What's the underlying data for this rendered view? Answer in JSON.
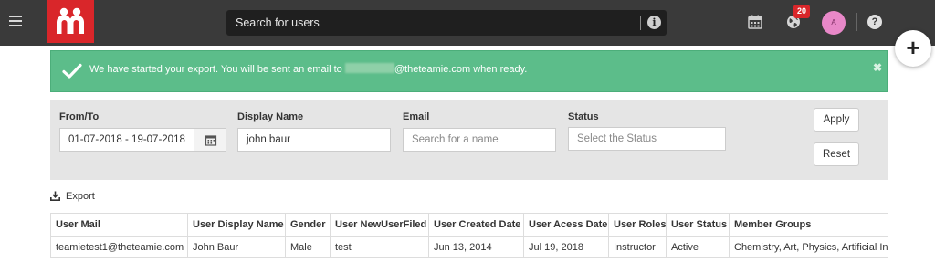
{
  "topbar": {
    "search_placeholder": "Search for users",
    "notification_count": "20",
    "avatar_initial": "A",
    "help_glyph": "?",
    "info_glyph": "i",
    "fab_glyph": "+"
  },
  "alert": {
    "text_before": "We have started your export. You will be sent an email to ",
    "text_after": "@theteamie.com when ready.",
    "close_glyph": "✖"
  },
  "filters": {
    "from_to_label": "From/To",
    "date_range": "01-07-2018 - 19-07-2018",
    "display_name_label": "Display Name",
    "display_name_value": "john baur",
    "email_label": "Email",
    "email_placeholder": "Search for a name",
    "status_label": "Status",
    "status_placeholder": "Select the Status",
    "apply_label": "Apply",
    "reset_label": "Reset"
  },
  "export_label": "Export",
  "table": {
    "headers": [
      "User Mail",
      "User Display Name",
      "Gender",
      "User NewUserFiled",
      "User Created Date",
      "User Acess Date",
      "User Roles",
      "User Status",
      "Member Groups"
    ],
    "rows": [
      [
        "teamietest1@theteamie.com",
        "John Baur",
        "Male",
        "test",
        "Jun 13, 2014",
        "Jul 19, 2018",
        "Instructor",
        "Active",
        "Chemistry, Art, Physics, Artificial Intelligence"
      ]
    ]
  },
  "colors": {
    "topbar": "#3a3a3a",
    "brand_red": "#d9262a",
    "success_green": "#5cbd8a",
    "avatar_pink": "#e888c8"
  }
}
